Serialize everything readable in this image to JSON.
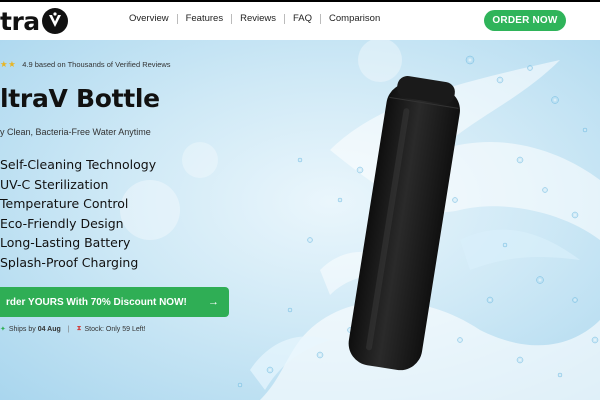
{
  "brand": {
    "logo_text": "tra"
  },
  "nav": {
    "items": [
      "Overview",
      "Features",
      "Reviews",
      "FAQ",
      "Comparison"
    ],
    "cta_label": "ORDER NOW"
  },
  "hero": {
    "stars": "★★",
    "rating_text": "4.9 based on Thousands of Verified Reviews",
    "title": "ltraV Bottle",
    "subtitle": "y Clean, Bacteria-Free Water Anytime",
    "features": [
      "Self-Cleaning Technology",
      "UV-C Sterilization",
      "Temperature Control",
      "Eco-Friendly Design",
      "Long-Lasting Battery",
      "Splash-Proof Charging"
    ],
    "cta_label": "rder YOURS With 70% Discount NOW!",
    "cta_arrow": "→",
    "ships_prefix": "Ships by",
    "ships_date": "04 Aug",
    "separator": "|",
    "stock_text": "Stock: Only 59 Left!"
  },
  "colors": {
    "accent_green": "#2fb45a",
    "star_yellow": "#e9b522",
    "bottle": "#1b1b1b",
    "water": "#8ccbeb"
  }
}
